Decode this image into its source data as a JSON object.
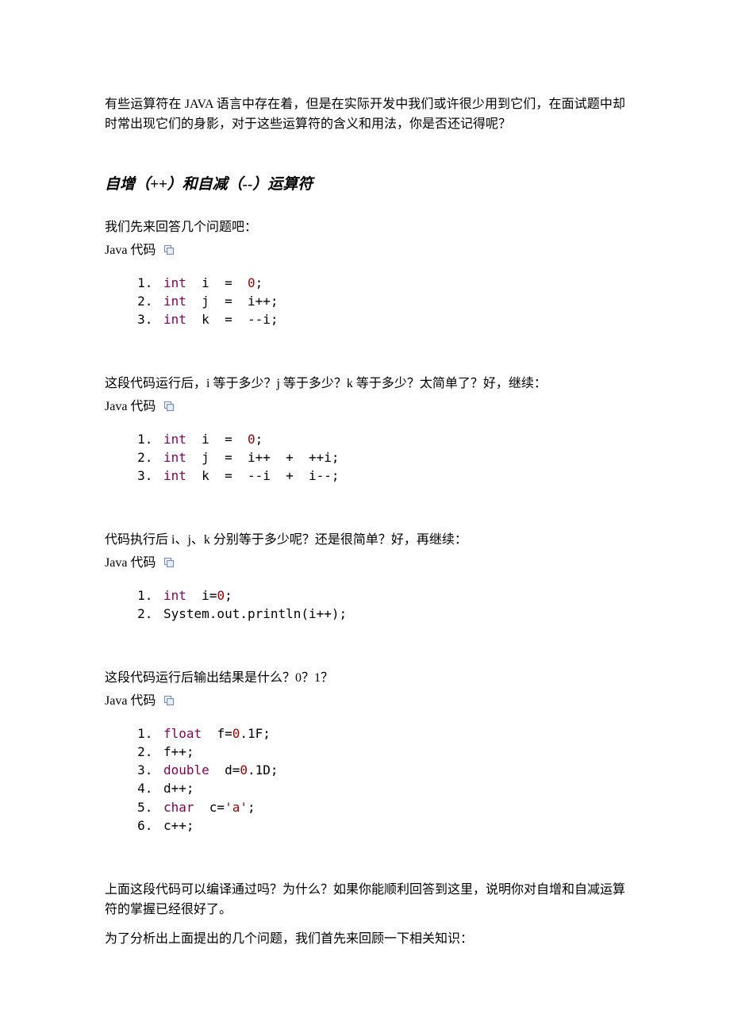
{
  "intro": "有些运算符在 JAVA 语言中存在着，但是在实际开发中我们或许很少用到它们，在面试题中却时常出现它们的身影，对于这些运算符的含义和用法，你是否还记得呢？",
  "heading1": "自增（++）和自减（--）运算符",
  "q1": "我们先来回答几个问题吧：",
  "label": "Java 代码",
  "block1": {
    "l1_pre": "int  i  =  ",
    "l1_lit": "0",
    "l1_post": ";",
    "l2": "int  j  =  i++;",
    "l3": "int  k  =  --i;"
  },
  "q2": "这段代码运行后，i 等于多少？j 等于多少？k 等于多少？太简单了？好，继续：",
  "block2": {
    "l1_pre": "int  i  =  ",
    "l1_lit": "0",
    "l1_post": ";",
    "l2": "int  j  =  i++  +  ++i;",
    "l3": "int  k  =  --i  +  i--;"
  },
  "q3": "代码执行后 i、j、k 分别等于多少呢？还是很简单？好，再继续：",
  "block3": {
    "l1_pre": "int  i=",
    "l1_lit": "0",
    "l1_post": ";",
    "l2": "System.out.println(i++);"
  },
  "q4": "这段代码运行后输出结果是什么？0？1？",
  "block4": {
    "l1_pre": "float  f=",
    "l1_lit": "0",
    "l1_post": ".1F;",
    "l2": "f++;",
    "l3_pre": "double  d=",
    "l3_lit": "0",
    "l3_post": ".1D;",
    "l4": "d++;",
    "l5_pre": "char  c=",
    "l5_chr": "'a'",
    "l5_post": ";",
    "l6": "c++;"
  },
  "p5": "上面这段代码可以编译通过吗？为什么？如果你能顺利回答到这里，说明你对自增和自减运算符的掌握已经很好了。",
  "p6": "为了分析出上面提出的几个问题，我们首先来回顾一下相关知识："
}
